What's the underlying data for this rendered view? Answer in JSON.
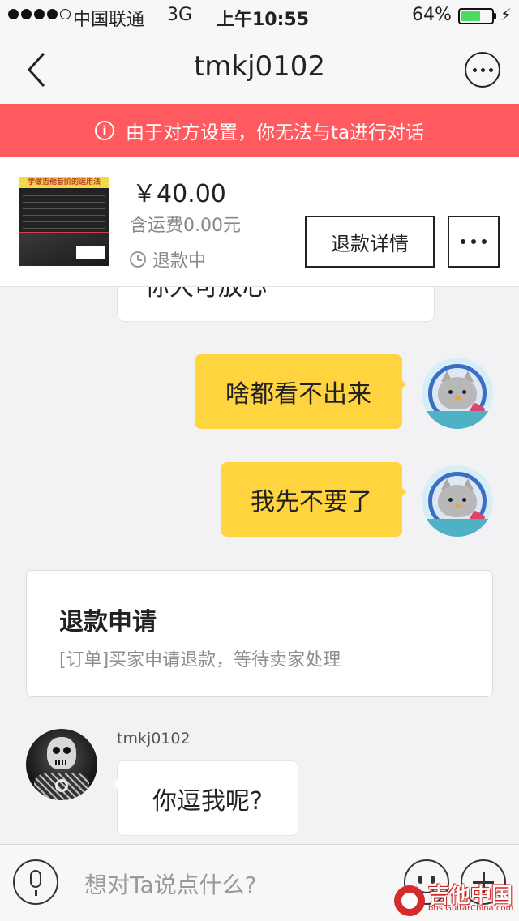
{
  "status_bar": {
    "carrier": "中国联通",
    "network": "3G",
    "time": "上午10:55",
    "battery_text": "64%",
    "battery_level": 0.64,
    "battery_color": "#4cd964"
  },
  "nav": {
    "back_icon": "chevron-left-icon",
    "title": "tmkj0102",
    "more_icon": "more-circle-icon"
  },
  "warning": {
    "icon": "info-icon",
    "icon_glyph": "i",
    "text": "由于对方设置，你无法与ta进行对话",
    "color": "#ff5a5f"
  },
  "order": {
    "product_thumb_text": "学做吉他音阶的运用法",
    "price": "￥40.00",
    "shipping": "含运费0.00元",
    "status": "退款中",
    "refund_button": "退款详情",
    "more_icon": "more-horizontal-icon"
  },
  "messages": {
    "partial_left": "你大可放心",
    "right_1": "啥都看不出来",
    "right_2": "我先不要了",
    "bubble_color": "#ffd43f"
  },
  "card": {
    "title": "退款申请",
    "description": "[订单]买家申请退款，等待卖家处理"
  },
  "incoming": {
    "sender": "tmkj0102",
    "text": "你逗我呢?"
  },
  "input": {
    "placeholder": "想对Ta说点什么?",
    "mic_icon": "microphone-icon",
    "emoji_icon": "emoji-icon",
    "plus_icon": "plus-icon"
  },
  "watermark": {
    "text": "吉他中国",
    "url": "bbs.GuitarChina.com"
  }
}
